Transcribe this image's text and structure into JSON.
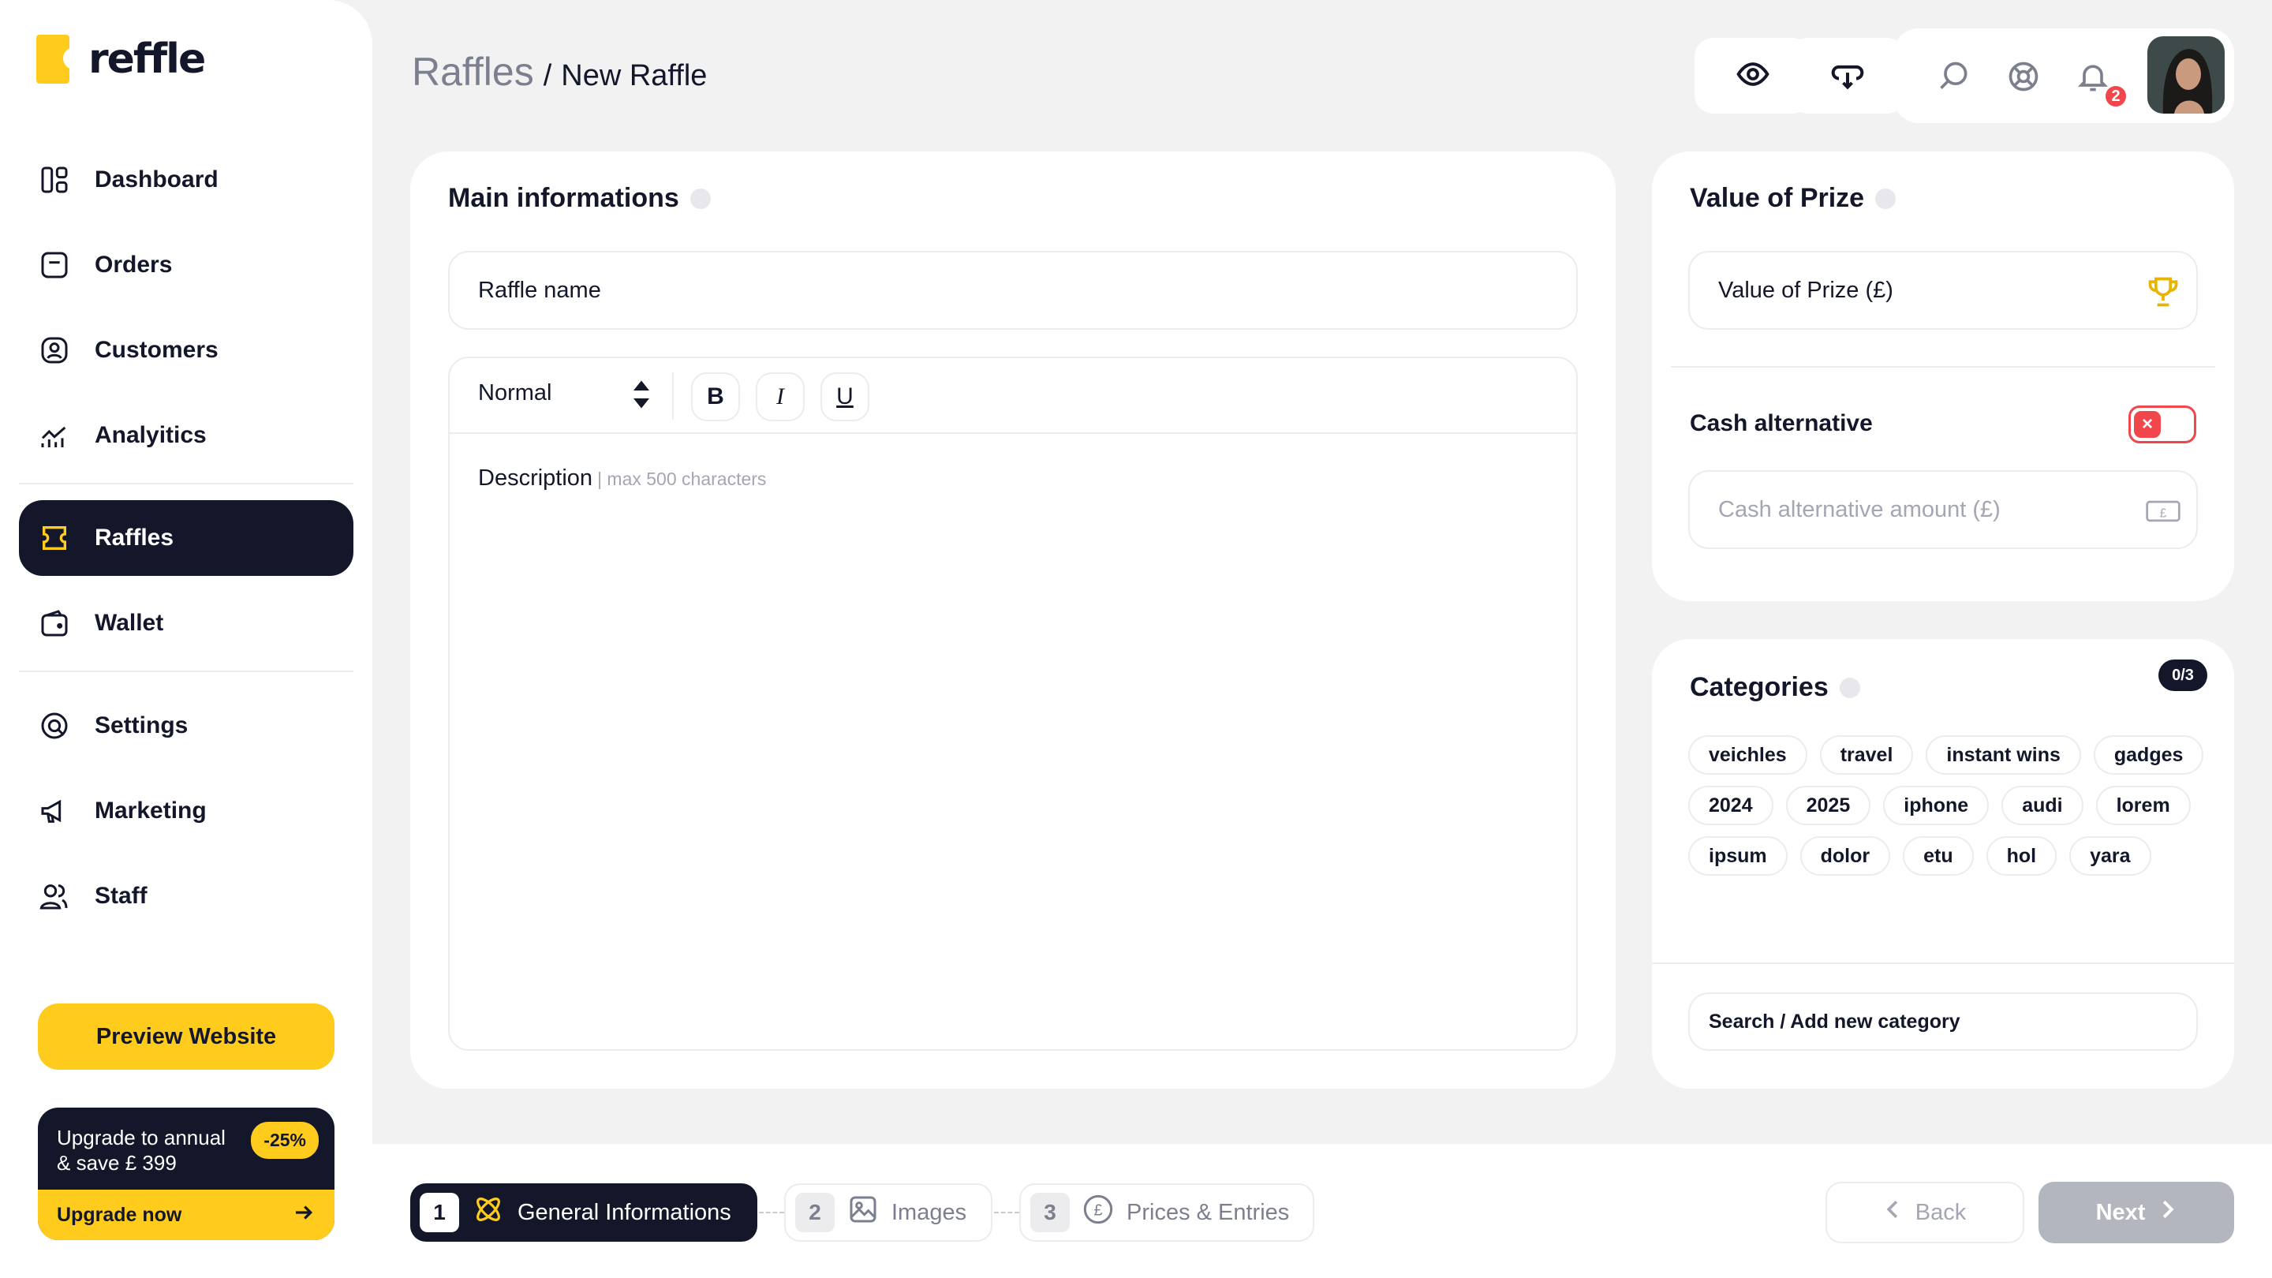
{
  "brand": {
    "logo_text": "reffle",
    "accent": "#ffcc1d",
    "dark": "#14172a",
    "danger": "#f0464c"
  },
  "sidebar": {
    "items": [
      {
        "label": "Dashboard",
        "icon": "dashboard-icon"
      },
      {
        "label": "Orders",
        "icon": "orders-icon"
      },
      {
        "label": "Customers",
        "icon": "customers-icon"
      },
      {
        "label": "Analyitics",
        "icon": "analytics-icon"
      },
      {
        "label": "Raffles",
        "icon": "ticket-icon",
        "active": true
      },
      {
        "label": "Wallet",
        "icon": "wallet-icon"
      },
      {
        "label": "Settings",
        "icon": "settings-icon"
      },
      {
        "label": "Marketing",
        "icon": "megaphone-icon"
      },
      {
        "label": "Staff",
        "icon": "staff-icon"
      }
    ],
    "preview_label": "Preview Website",
    "upgrade": {
      "line1": "Upgrade to annual",
      "line2": "& save £ 399",
      "discount": "-25%",
      "cta": "Upgrade now"
    }
  },
  "header": {
    "breadcrumb_root": "Raffles",
    "breadcrumb_sep": "/",
    "breadcrumb_current": "New Raffle",
    "notification_count": "2"
  },
  "main_info": {
    "title": "Main informations",
    "raffle_name_placeholder": "Raffle name",
    "format_select": "Normal",
    "bold": "B",
    "italic": "I",
    "underline": "U",
    "description_label": "Description",
    "description_hint": "| max 500 characters"
  },
  "prize": {
    "title": "Value of Prize",
    "value_placeholder": "Value of Prize (£)",
    "cash_alt_label": "Cash alternative",
    "cash_alt_enabled": false,
    "cash_alt_placeholder": "Cash alternative amount (£)"
  },
  "categories": {
    "title": "Categories",
    "count": "0/3",
    "tags": [
      "veichles",
      "travel",
      "instant wins",
      "gadges",
      "2024",
      "2025",
      "iphone",
      "audi",
      "lorem",
      "ipsum",
      "dolor",
      "etu",
      "hol",
      "yara"
    ],
    "search_placeholder": "Search / Add new category"
  },
  "steps": [
    {
      "num": "1",
      "label": "General Informations",
      "active": true
    },
    {
      "num": "2",
      "label": "Images",
      "active": false
    },
    {
      "num": "3",
      "label": "Prices & Entries",
      "active": false
    }
  ],
  "footer": {
    "back_label": "Back",
    "next_label": "Next"
  }
}
